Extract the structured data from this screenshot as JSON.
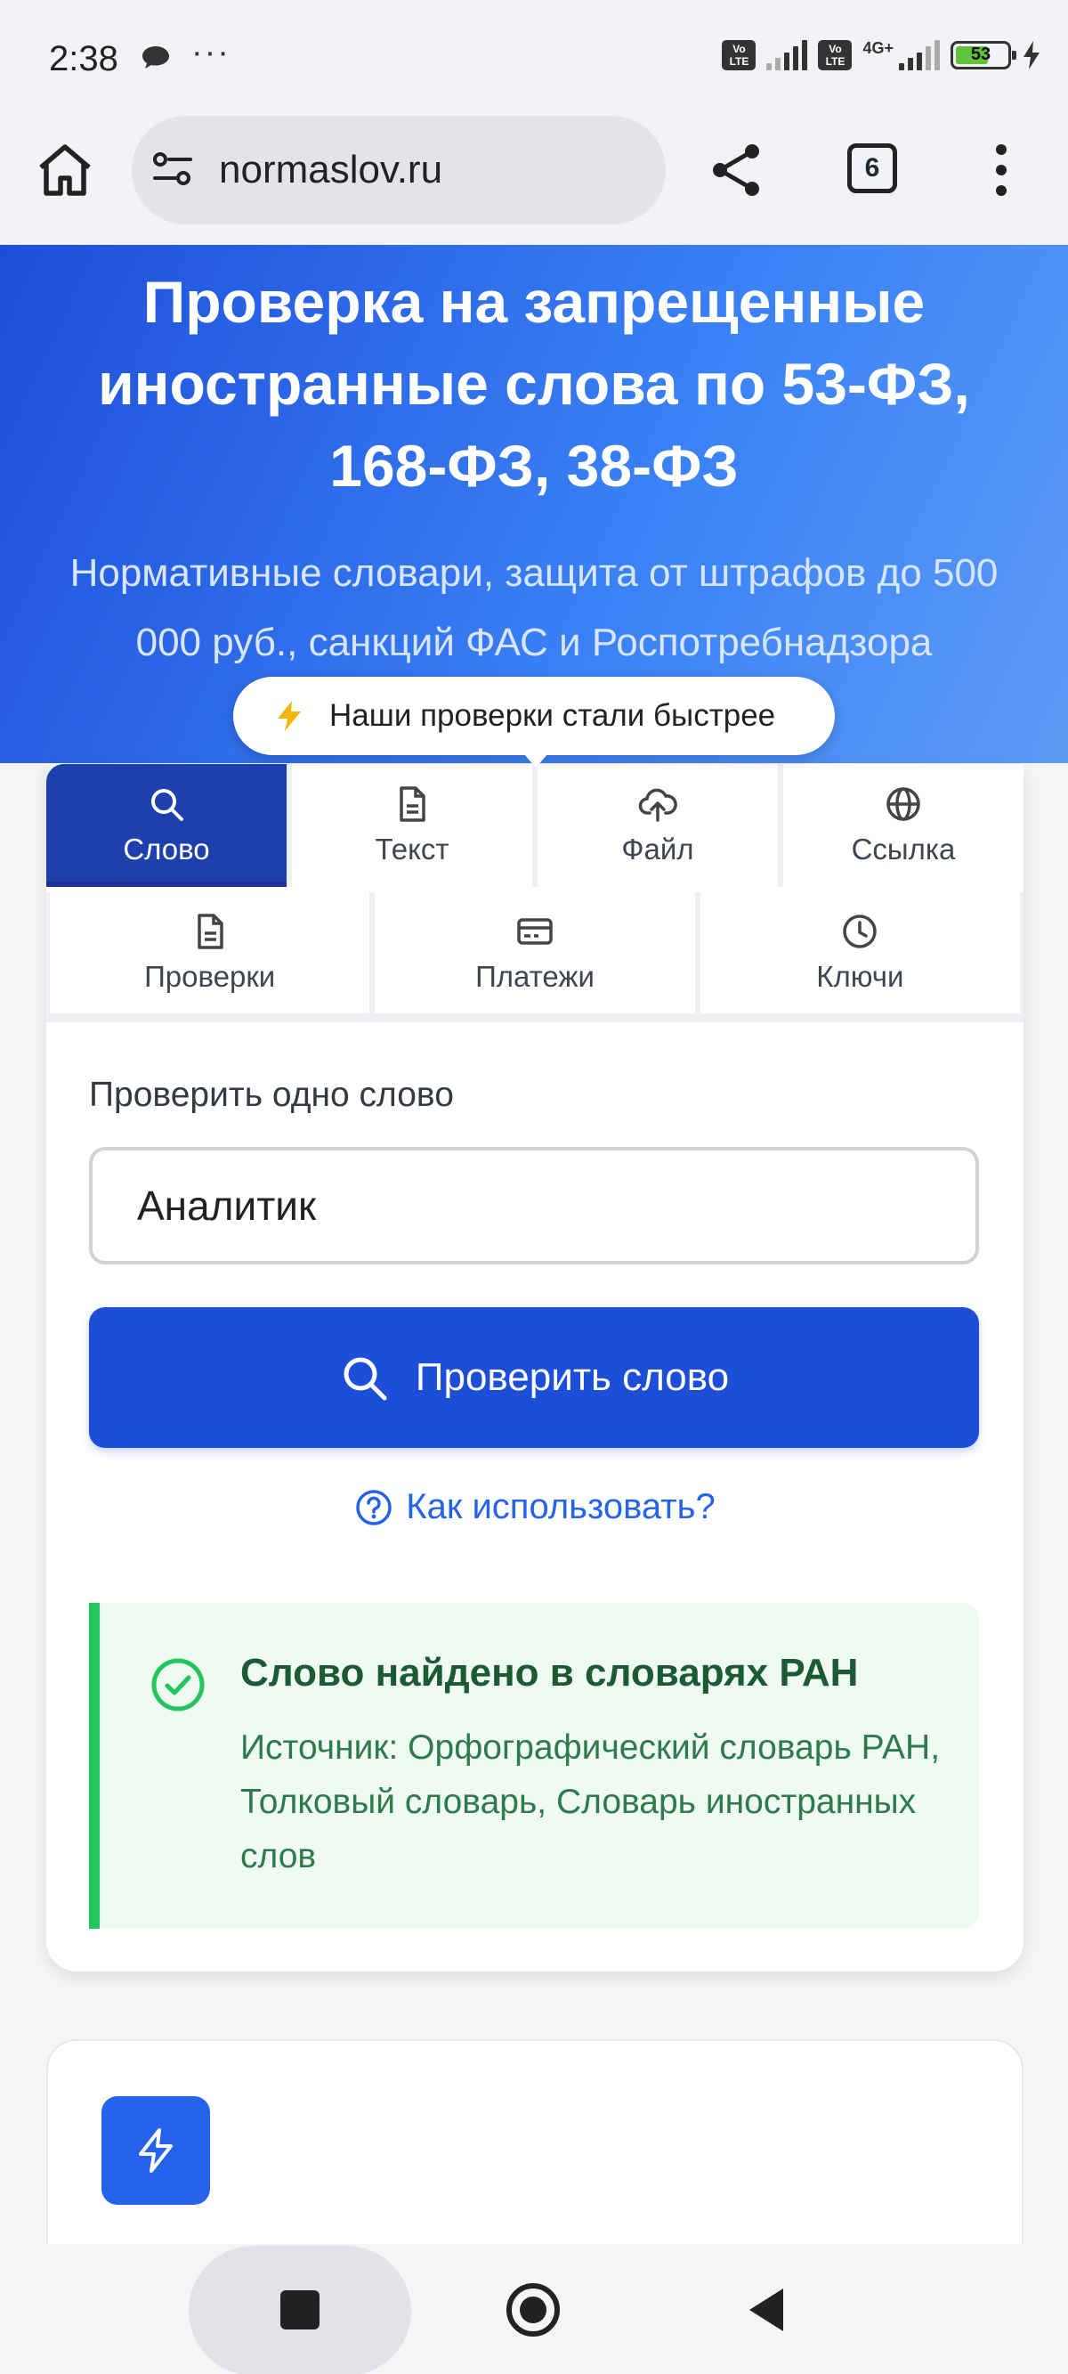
{
  "status_bar": {
    "time": "2:38",
    "more": "···",
    "network": "4G+",
    "battery": "53",
    "volte": "Vo LTE"
  },
  "browser": {
    "url": "normaslov.ru",
    "tab_count": "6"
  },
  "hero": {
    "title": "Проверка на запрещенные иностранные слова по 53-ФЗ, 168-ФЗ, 38-ФЗ",
    "subtitle": "Нормативные словари, защита от штрафов до 500 000 руб., санкций ФАС и Роспотребнадзора",
    "tooltip": "Наши проверки стали быстрее"
  },
  "tabs": {
    "row1": [
      {
        "label": "Слово",
        "icon": "search-icon"
      },
      {
        "label": "Текст",
        "icon": "document-icon"
      },
      {
        "label": "Файл",
        "icon": "upload-cloud-icon"
      },
      {
        "label": "Ссылка",
        "icon": "globe-icon"
      }
    ],
    "row2": [
      {
        "label": "Проверки",
        "icon": "document-icon"
      },
      {
        "label": "Платежи",
        "icon": "credit-card-icon"
      },
      {
        "label": "Ключи",
        "icon": "clock-icon"
      }
    ]
  },
  "form": {
    "label": "Проверить одно слово",
    "value": "Аналитик",
    "button": "Проверить слово",
    "help": "Как использовать?"
  },
  "result": {
    "title": "Слово найдено в словарях РАН",
    "text": "Источник: Орфографический словарь РАН, Толковый словарь, Словарь иностранных слов"
  },
  "colors": {
    "primary": "#1d4ed8",
    "active_tab": "#1e40af",
    "success": "#22c55e",
    "success_bg": "#effbf2"
  }
}
